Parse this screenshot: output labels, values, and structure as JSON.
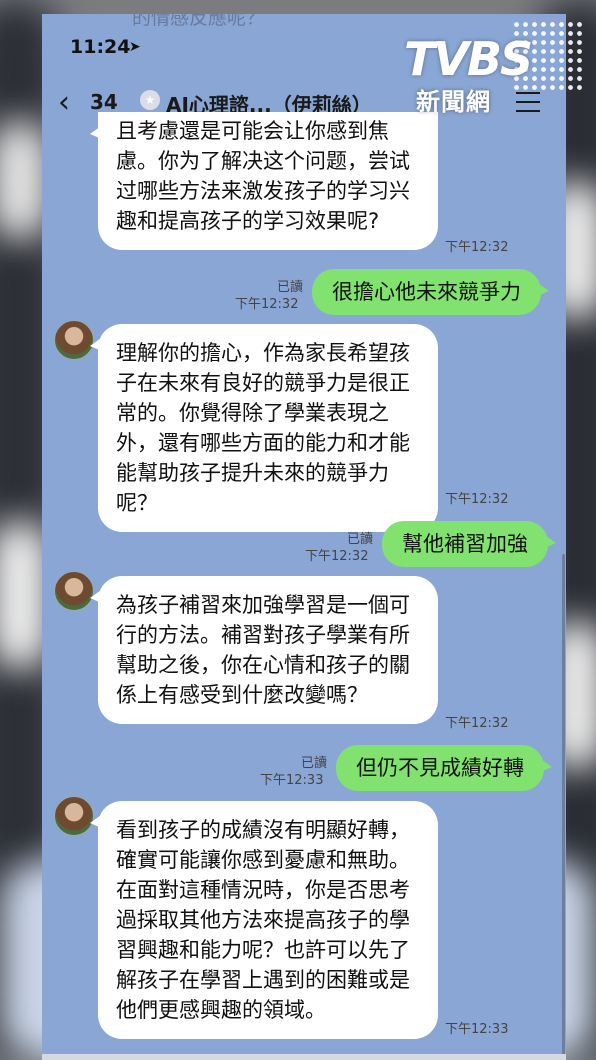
{
  "status": {
    "time": "11:24"
  },
  "header": {
    "back_count": "34",
    "title": "AI心理諮...（伊莉絲）",
    "faded_text": "的情感反應呢？"
  },
  "watermark": {
    "brand": "TVBS",
    "sub": "新聞網"
  },
  "messages": [
    {
      "side": "in",
      "text": "且考慮還是可能会让你感到焦慮。你为了解决这个问题，尝试过哪些方法来激发孩子的学习兴趣和提高孩子的学习效果呢?",
      "time": "下午12:32"
    },
    {
      "side": "out",
      "text": "很擔心他未來競爭力",
      "read": "已讀",
      "time": "下午12:32"
    },
    {
      "side": "in",
      "text": "理解你的擔心，作為家長希望孩子在未來有良好的競爭力是很正常的。你覺得除了學業表現之外，還有哪些方面的能力和才能能幫助孩子提升未來的競爭力呢？",
      "time": "下午12:32"
    },
    {
      "side": "out",
      "text": "幫他補習加強",
      "read": "已讀",
      "time": "下午12:32"
    },
    {
      "side": "in",
      "text": "為孩子補習來加強學習是一個可行的方法。補習對孩子學業有所幫助之後，你在心情和孩子的關係上有感受到什麼改變嗎？",
      "time": "下午12:32"
    },
    {
      "side": "out",
      "text": "但仍不見成績好轉",
      "read": "已讀",
      "time": "下午12:33"
    },
    {
      "side": "in",
      "text": "看到孩子的成績沒有明顯好轉，確實可能讓你感到憂慮和無助。在面對這種情況時，你是否思考過採取其他方法來提高孩子的學習興趣和能力呢？也許可以先了解孩子在學習上遇到的困難或是他們更感興趣的領域。",
      "time": "下午12:33"
    }
  ],
  "colors": {
    "chat_bg": "#8aa6d4",
    "bubble_out": "#82e26f",
    "bubble_in": "#ffffff"
  },
  "icons": [
    "back-chevron-icon",
    "location-arrow-icon",
    "shield-badge-icon",
    "menu-icon",
    "avatar-icon"
  ]
}
